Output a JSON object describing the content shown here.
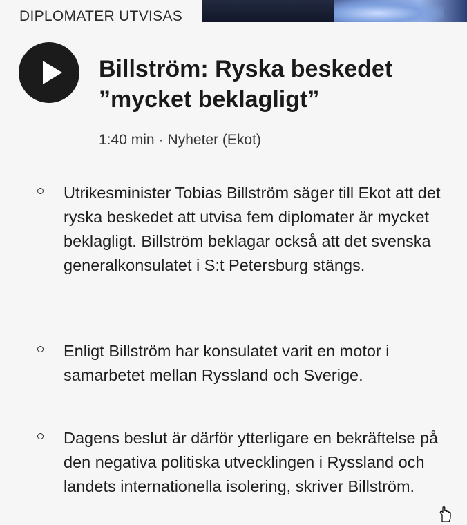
{
  "article": {
    "kicker": "DIPLOMATER UTVISAS",
    "headline": "Billström: Ryska beskedet ”mycket beklagligt”",
    "duration": "1:40 min",
    "separator": "·",
    "source": "Nyheter (Ekot)",
    "bullets": [
      "Utrikesminister Tobias Billström säger till Ekot att det ryska beskedet att utvisa fem diplomater är mycket beklagligt. Billström beklagar också att det svenska generalkonsulatet i S:t Petersburg stängs.",
      "Enligt Billström har konsulatet varit en motor i samarbetet mellan Ryssland och Sverige.",
      "Dagens beslut är därför ytterligare en bekräftelse på den negativa politiska utvecklingen i Ryssland och landets internationella isolering, skriver Billström."
    ]
  },
  "icons": {
    "play": "play-icon",
    "cursor": "hand-pointer-icon"
  }
}
